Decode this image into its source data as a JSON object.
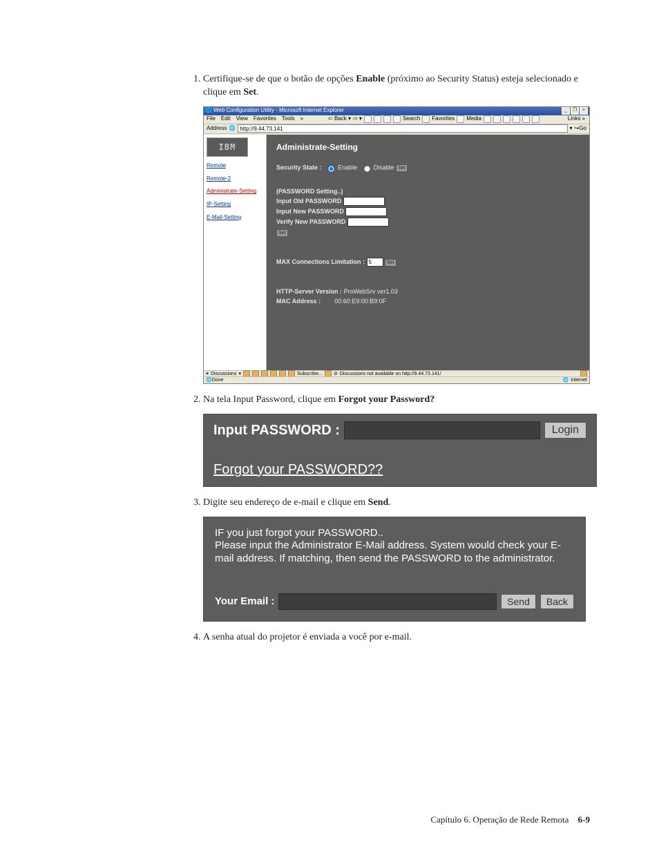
{
  "steps": {
    "s1_a": "Certifique-se de que o botão de opções ",
    "s1_b": "Enable",
    "s1_c": " (próximo ao Security Status) esteja selecionado e clique em ",
    "s1_d": "Set",
    "s1_e": ".",
    "s2_a": "Na tela Input Password, clique em ",
    "s2_b": "Forgot your Password?",
    "s3_a": "Digite seu endereço de e-mail e clique em ",
    "s3_b": "Send",
    "s3_c": ".",
    "s4": "A senha atual do projetor é enviada a você por e-mail."
  },
  "ie": {
    "title": "Web Configuration Utility - Microsoft Internet Explorer",
    "menus": [
      "File",
      "Edit",
      "View",
      "Favorites",
      "Tools"
    ],
    "links_label": "Links",
    "toolbar": {
      "back": "Back",
      "search": "Search",
      "favorites": "Favorites",
      "media": "Media"
    },
    "address_label": "Address",
    "address_value": "http://9.44.73.141",
    "go": "Go",
    "side": {
      "remote": "Remote",
      "remote2": "Remote-2",
      "admin": "Administrate-Setting",
      "ip": "IP-Setting",
      "email": "E-Mail-Setting"
    },
    "main": {
      "heading": "Administrate-Setting",
      "sec_state_label": "Security State :",
      "enable": "Enable",
      "disable": "Disable",
      "set_btn": "Set",
      "pw_heading": "(PASSWORD Setting..)",
      "old_pw": "Input Old PASSWORD",
      "new_pw": "Input New PASSWORD",
      "verify_pw": "Verify New PASSWORD",
      "max_conn_label": "MAX Connections Limitation :",
      "max_conn_value": "5",
      "http_label": "HTTP-Server Version :",
      "http_value": "ProWebSrv ver1.03",
      "mac_label": "MAC Address :",
      "mac_value": "00:60:E9:00:B9:0F"
    },
    "status": {
      "discussions": "Discussions",
      "subscribe": "Subscribe...",
      "not_avail": "Discussions not available on http://9.44.73.141/",
      "done": "Done",
      "zone": "Internet"
    }
  },
  "login_panel": {
    "label": "Input PASSWORD :",
    "login_btn": "Login",
    "forgot": "Forgot your PASSWORD??"
  },
  "forgot_panel": {
    "msg_l1": "IF you just forgot your PASSWORD..",
    "msg_l2": "Please input the Administrator E-Mail address. System would check your E-mail address. If matching, then send the PASSWORD to the administrator.",
    "email_label": "Your Email :",
    "send_btn": "Send",
    "back_btn": "Back"
  },
  "footer": {
    "chapter": "Capítulo 6. Operação de Rede Remota",
    "page": "6-9"
  }
}
